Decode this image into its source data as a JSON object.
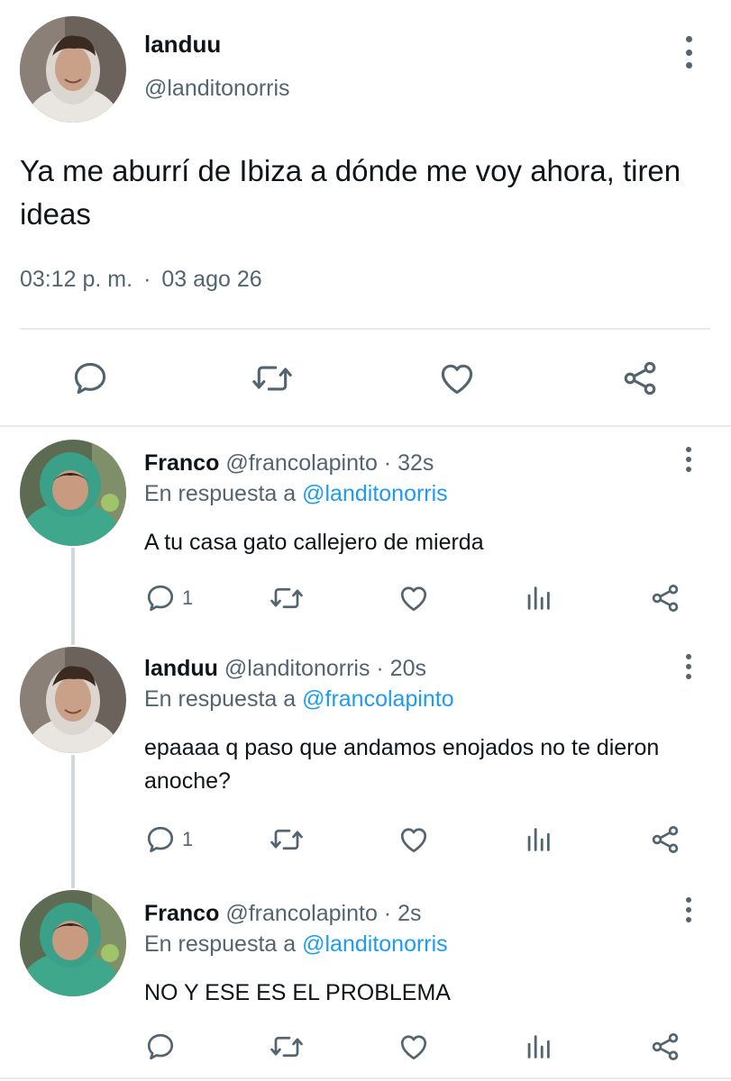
{
  "main_tweet": {
    "name": "landuu",
    "handle": "@landitonorris",
    "text": "Ya me aburrí de Ibiza a dónde me voy ahora, tiren ideas",
    "time": "03:12 p. m.",
    "separator": "·",
    "date": "03 ago 26"
  },
  "replies": [
    {
      "name": "Franco",
      "handle": "@francolapinto",
      "time": "· 32s",
      "reply_prefix": "En respuesta a",
      "reply_to": "@landitonorris",
      "text": "A tu casa gato callejero de mierda",
      "reply_count": "1"
    },
    {
      "name": "landuu",
      "handle": "@landitonorris",
      "time": "· 20s",
      "reply_prefix": "En respuesta a",
      "reply_to": "@francolapinto",
      "text": "epaaaa q paso que andamos enojados no te dieron anoche?",
      "reply_count": "1"
    },
    {
      "name": "Franco",
      "handle": "@francolapinto",
      "time": "· 2s",
      "reply_prefix": "En respuesta a",
      "reply_to": "@landitonorris",
      "text": "NO Y ESE ES EL PROBLEMA",
      "reply_count": ""
    }
  ],
  "icons": [
    "reply-icon",
    "retweet-icon",
    "like-icon",
    "share-icon",
    "analytics-icon",
    "more-icon"
  ],
  "colors": {
    "text": "#0f1419",
    "secondary": "#536471",
    "link": "#1d9bf0",
    "divider": "#e8ebed"
  }
}
